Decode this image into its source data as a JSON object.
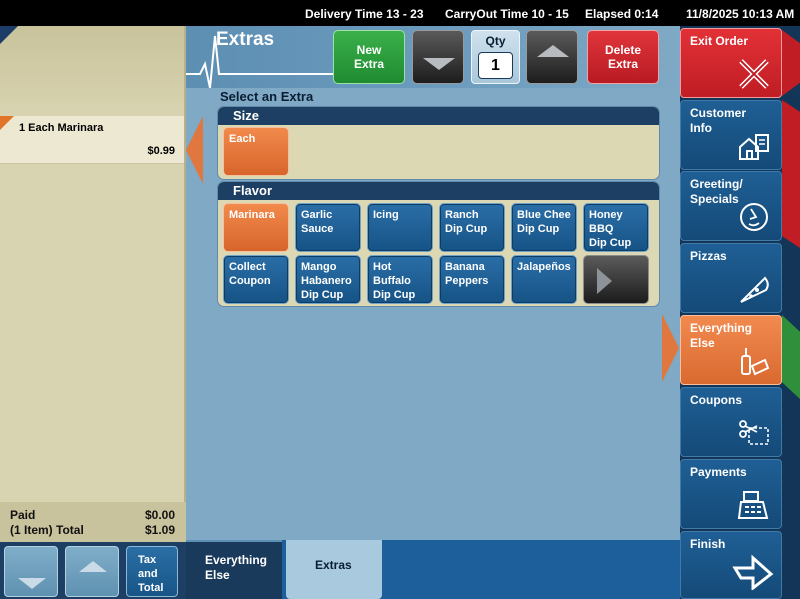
{
  "status_bar": {
    "delivery_time": "Delivery Time 13 - 23",
    "carryout_time": "CarryOut Time 10 - 15",
    "elapsed": "Elapsed 0:14",
    "datetime": "11/8/2025 10:13 AM"
  },
  "order": {
    "items": [
      {
        "name": "1 Each Marinara",
        "price": "$0.99"
      }
    ],
    "paid_label": "Paid",
    "paid_value": "$0.00",
    "total_label": "(1 Item) Total",
    "total_value": "$1.09",
    "tax_button": [
      "Tax",
      "and",
      "Total"
    ]
  },
  "center": {
    "title": "Extras",
    "new_extra": [
      "New",
      "Extra"
    ],
    "qty_label": "Qty",
    "qty_value": "1",
    "delete_extra": [
      "Delete",
      "Extra"
    ],
    "select_label": "Select an Extra",
    "size_group": {
      "title": "Size",
      "options": [
        {
          "label": [
            "Each"
          ],
          "selected": true
        }
      ]
    },
    "flavor_group": {
      "title": "Flavor",
      "options": [
        {
          "label": [
            "Marinara"
          ],
          "selected": true
        },
        {
          "label": [
            "Garlic",
            "Sauce"
          ],
          "selected": false
        },
        {
          "label": [
            "Icing"
          ],
          "selected": false
        },
        {
          "label": [
            "Ranch",
            "Dip Cup"
          ],
          "selected": false
        },
        {
          "label": [
            "Blue Chee",
            "Dip Cup"
          ],
          "selected": false
        },
        {
          "label": [
            "Honey",
            "BBQ",
            "Dip Cup"
          ],
          "selected": false
        },
        {
          "label": [
            "Collect",
            "Coupon"
          ],
          "selected": false
        },
        {
          "label": [
            "Mango",
            "Habanero",
            "Dip Cup"
          ],
          "selected": false
        },
        {
          "label": [
            "Hot",
            "Buffalo",
            "Dip Cup"
          ],
          "selected": false
        },
        {
          "label": [
            "Banana",
            "Peppers"
          ],
          "selected": false
        },
        {
          "label": [
            "Jalapeños"
          ],
          "selected": false
        }
      ]
    }
  },
  "bottom_tabs": {
    "everything_else": [
      "Everything",
      "Else"
    ],
    "extras": "Extras"
  },
  "right_nav": [
    {
      "label": [
        "Exit Order"
      ],
      "icon": "exit-x-icon",
      "color": "#e23137"
    },
    {
      "label": [
        "Customer",
        "Info"
      ],
      "icon": "customer-house-icon",
      "color": "#1f5f95"
    },
    {
      "label": [
        "Greeting/",
        "Specials"
      ],
      "icon": "greeting-face-icon",
      "color": "#1f5f95"
    },
    {
      "label": [
        "Pizzas"
      ],
      "icon": "pizza-slice-icon",
      "color": "#1f5f95"
    },
    {
      "label": [
        "Everything",
        "Else"
      ],
      "icon": "drink-icon",
      "color": "#f28a4f"
    },
    {
      "label": [
        "Coupons"
      ],
      "icon": "scissors-coupon-icon",
      "color": "#1f5f95"
    },
    {
      "label": [
        "Payments"
      ],
      "icon": "cash-register-icon",
      "color": "#1f5f95"
    },
    {
      "label": [
        "Finish"
      ],
      "icon": "finish-arrow-icon",
      "color": "#1f5f95"
    }
  ],
  "colors": {
    "accent_orange": "#e0773e",
    "panel_blue": "#7fa9c4",
    "nav_blue": "#1f5f95",
    "exit_red": "#e23137",
    "new_green": "#1f8b31",
    "order_beige": "#d8d3b0"
  }
}
